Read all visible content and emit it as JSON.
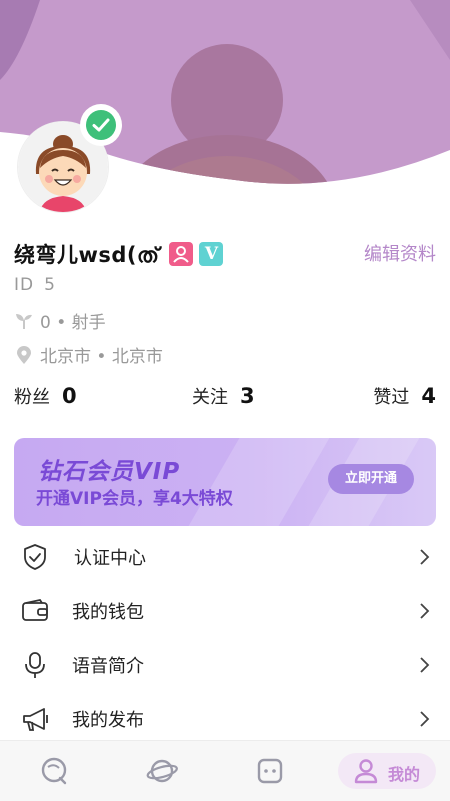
{
  "profile": {
    "name": "绕弯儿wsd(ത്",
    "edit_label": "编辑资料",
    "id_label": "ID",
    "id_value": "5",
    "zodiac_text": "0 • 射手",
    "location_text": "北京市 • 北京市",
    "tag_v_text": "V"
  },
  "stats": {
    "fans_label": "粉丝",
    "fans_value": "0",
    "follow_label": "关注",
    "follow_value": "3",
    "liked_label": "赞过",
    "liked_value": "4"
  },
  "vip": {
    "title": "钻石会员VIP",
    "subtitle": "开通VIP会员，享4大特权",
    "button_label": "立即开通"
  },
  "menu": {
    "items": [
      {
        "label": "认证中心",
        "icon": "shield-check-icon"
      },
      {
        "label": "我的钱包",
        "icon": "wallet-icon"
      },
      {
        "label": "语音简介",
        "icon": "microphone-icon"
      },
      {
        "label": "我的发布",
        "icon": "megaphone-icon"
      }
    ]
  },
  "tabbar": {
    "me_label": "我的"
  },
  "colors": {
    "header": "#c59acb",
    "accent": "#b487c9",
    "vip_text": "#7a4ad6",
    "verified": "#3ec07a"
  }
}
